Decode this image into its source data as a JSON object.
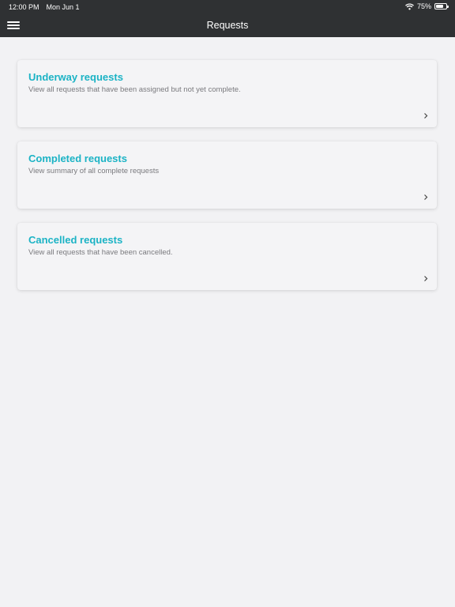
{
  "status_bar": {
    "time": "12:00 PM",
    "date": "Mon Jun 1",
    "battery_text": "75%",
    "battery_level": 0.75
  },
  "nav": {
    "title": "Requests"
  },
  "cards": [
    {
      "title": "Underway requests",
      "description": "View all requests that have been assigned but not yet complete."
    },
    {
      "title": "Completed requests",
      "description": "View summary of all complete requests"
    },
    {
      "title": "Cancelled requests",
      "description": "View all requests that have been cancelled."
    }
  ],
  "colors": {
    "header": "#2f3133",
    "accent": "#1bb3c5",
    "background": "#f2f2f4"
  },
  "icons": {
    "menu": "hamburger-menu-icon",
    "chevron": "chevron-right-icon",
    "wifi": "wifi-icon",
    "battery": "battery-icon"
  }
}
